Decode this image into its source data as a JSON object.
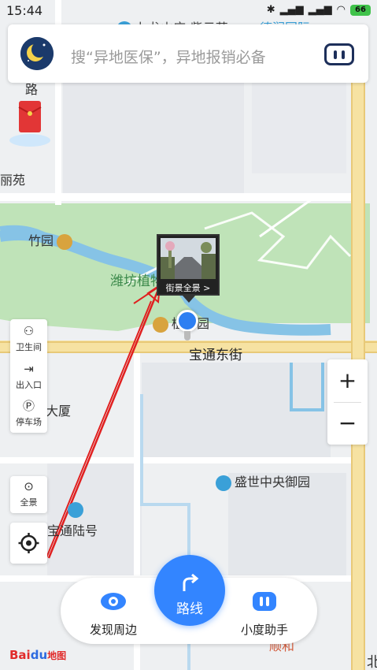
{
  "status": {
    "time": "15:44",
    "battery": "66"
  },
  "search": {
    "placeholder": "搜“异地医保”，异地报销必备",
    "avatar_icon": "moon-avatar-icon",
    "assistant_icon": "xiaodu-bot-icon"
  },
  "map": {
    "labels": {
      "top_poi": "九龙山庄-紫云苑",
      "top_right": "德润国际",
      "left_road": "路",
      "left_garden": "丽苑",
      "bamboo_garden": "竹园",
      "weifang_park": "潍坊植物园",
      "park_gate": "植物园",
      "street": "宝通东街",
      "mansion": "大厦",
      "residence": "盛世中央御园",
      "baotong": "宝通陆号",
      "bottom_right": "顺和",
      "edge_char": "北"
    },
    "streetview_label": "街景全景 >"
  },
  "tools": {
    "restroom": "卫生间",
    "entrance": "出入口",
    "parking": "停车场",
    "panorama": "全景"
  },
  "zoom": {
    "in": "+",
    "out": "−"
  },
  "bottom": {
    "discover": "发现周边",
    "route": "路线",
    "assistant": "小度助手"
  },
  "brand": {
    "logo_bai": "Bai",
    "logo_du": "du",
    "logo_map": "地图"
  },
  "colors": {
    "park_green": "#bfe3b8",
    "water_blue": "#86c3e6",
    "road_yellow": "#f6e2a2",
    "accent_blue": "#3385ff",
    "annotation_red": "#e02020"
  }
}
